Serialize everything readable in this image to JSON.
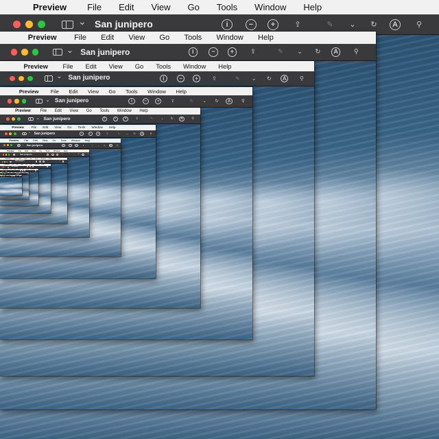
{
  "menubar": {
    "app_name": "Preview",
    "items": [
      "File",
      "Edit",
      "View",
      "Go",
      "Tools",
      "Window",
      "Help"
    ]
  },
  "window": {
    "title": "San junipero"
  },
  "icons": [
    "sidebar-icon",
    "chevron-down-icon",
    "info-icon",
    "zoom-out-icon",
    "zoom-in-icon",
    "share-icon",
    "markup-pen-icon",
    "chevron-down-icon",
    "rotate-icon",
    "annotate-icon",
    "search-icon"
  ],
  "colors": {
    "menubar_bg": "#f1f1f1",
    "titlebar_bg": "#3a3a3c",
    "close": "#ff5f57",
    "minimize": "#febc2e",
    "zoom": "#28c840"
  }
}
